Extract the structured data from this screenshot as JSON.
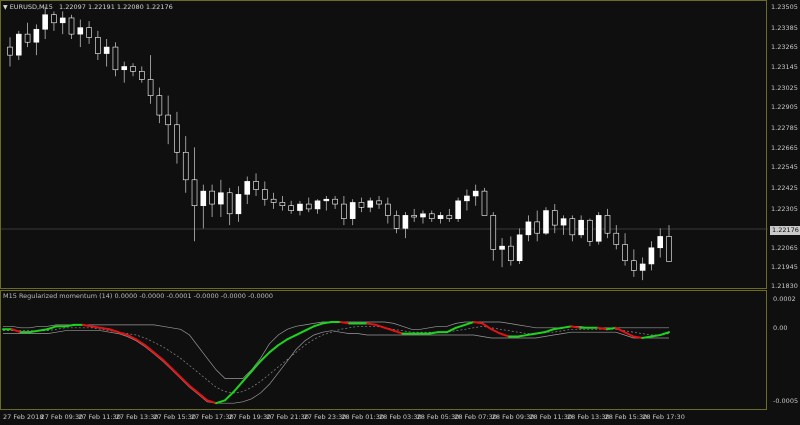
{
  "main_chart": {
    "symbol_label": "EURUSD,M15",
    "ohlc_text": "1.22097 1.22191 1.22080 1.22176",
    "dropdown_icon": "triangle-down-icon",
    "current_price": "1.22176",
    "price_axis": [
      "1.23505",
      "1.23385",
      "1.23265",
      "1.23145",
      "1.23025",
      "1.22905",
      "1.22785",
      "1.22665",
      "1.22545",
      "1.22425",
      "1.22305",
      "1.22065",
      "1.21945",
      "1.21830"
    ],
    "colors": {
      "background": "#0f0f0f",
      "frame": "#6b6b24",
      "candle": "#ffffff",
      "wick": "#bbbbbb"
    }
  },
  "indicator": {
    "title": "M15 Regularized momentum (14) 0.0000 -0.0000 -0.0001 -0.0000 -0.0000 -0.0000",
    "axis": [
      "0.0002",
      "0.00",
      "-0.0005"
    ],
    "colors": {
      "up": "#1fd41f",
      "down": "#e01414",
      "band": "#9a9a9a"
    }
  },
  "time_axis": [
    "27 Feb 2018",
    "27 Feb 09:30",
    "27 Feb 11:30",
    "27 Feb 13:30",
    "27 Feb 15:30",
    "27 Feb 17:30",
    "27 Feb 19:30",
    "27 Feb 21:30",
    "27 Feb 23:30",
    "28 Feb 01:30",
    "28 Feb 03:30",
    "28 Feb 05:30",
    "28 Feb 07:30",
    "28 Feb 09:30",
    "28 Feb 11:30",
    "28 Feb 13:30",
    "28 Feb 15:30",
    "28 Feb 17:30"
  ],
  "chart_data": [
    {
      "type": "candlestick",
      "title": "EURUSD,M15",
      "ylim": [
        1.2183,
        1.2356
      ],
      "candles": [
        [
          1.233,
          1.2336,
          1.2318,
          1.2325
        ],
        [
          1.2325,
          1.234,
          1.2322,
          1.2338
        ],
        [
          1.2338,
          1.2345,
          1.233,
          1.2333
        ],
        [
          1.2333,
          1.2344,
          1.2325,
          1.2341
        ],
        [
          1.2341,
          1.2355,
          1.2335,
          1.235
        ],
        [
          1.235,
          1.2352,
          1.234,
          1.2345
        ],
        [
          1.2345,
          1.2352,
          1.2338,
          1.2348
        ],
        [
          1.2348,
          1.235,
          1.2335,
          1.2338
        ],
        [
          1.2338,
          1.2347,
          1.233,
          1.2342
        ],
        [
          1.2342,
          1.2346,
          1.2332,
          1.2336
        ],
        [
          1.2336,
          1.234,
          1.2322,
          1.2326
        ],
        [
          1.2326,
          1.2335,
          1.2318,
          1.233
        ],
        [
          1.233,
          1.2333,
          1.2312,
          1.2316
        ],
        [
          1.2316,
          1.2321,
          1.2308,
          1.2318
        ],
        [
          1.2318,
          1.232,
          1.2312,
          1.2315
        ],
        [
          1.2315,
          1.2318,
          1.2308,
          1.231
        ],
        [
          1.231,
          1.2325,
          1.2295,
          1.23
        ],
        [
          1.23,
          1.2305,
          1.2283,
          1.2288
        ],
        [
          1.2288,
          1.23,
          1.227,
          1.2282
        ],
        [
          1.2282,
          1.229,
          1.2258,
          1.2265
        ],
        [
          1.2265,
          1.2275,
          1.224,
          1.2248
        ],
        [
          1.2248,
          1.2268,
          1.221,
          1.2232
        ],
        [
          1.2232,
          1.2245,
          1.2218,
          1.2241
        ],
        [
          1.2241,
          1.2245,
          1.2225,
          1.2233
        ],
        [
          1.2233,
          1.2248,
          1.2225,
          1.224
        ],
        [
          1.224,
          1.2243,
          1.222,
          1.2227
        ],
        [
          1.2227,
          1.2244,
          1.2222,
          1.2239
        ],
        [
          1.2239,
          1.225,
          1.2233,
          1.2247
        ],
        [
          1.2247,
          1.2252,
          1.2238,
          1.2242
        ],
        [
          1.2242,
          1.2247,
          1.2232,
          1.2236
        ],
        [
          1.2236,
          1.224,
          1.223,
          1.2234
        ],
        [
          1.2234,
          1.2238,
          1.2229,
          1.2232
        ],
        [
          1.2232,
          1.2235,
          1.2227,
          1.2229
        ],
        [
          1.2229,
          1.2235,
          1.2226,
          1.2233
        ],
        [
          1.2233,
          1.2237,
          1.2228,
          1.223
        ],
        [
          1.223,
          1.2236,
          1.2227,
          1.2235
        ],
        [
          1.2235,
          1.2238,
          1.2229,
          1.2236
        ],
        [
          1.2236,
          1.2238,
          1.223,
          1.2233
        ],
        [
          1.2233,
          1.2238,
          1.222,
          1.2224
        ],
        [
          1.2224,
          1.2236,
          1.222,
          1.2234
        ],
        [
          1.2234,
          1.2237,
          1.2228,
          1.2231
        ],
        [
          1.2231,
          1.2237,
          1.2228,
          1.2235
        ],
        [
          1.2235,
          1.2238,
          1.223,
          1.2233
        ],
        [
          1.2233,
          1.2237,
          1.2221,
          1.2226
        ],
        [
          1.2226,
          1.2229,
          1.2215,
          1.2218
        ],
        [
          1.2218,
          1.2228,
          1.2212,
          1.2226
        ],
        [
          1.2226,
          1.223,
          1.2222,
          1.2225
        ],
        [
          1.2225,
          1.2229,
          1.2221,
          1.2227
        ],
        [
          1.2227,
          1.2229,
          1.2222,
          1.2224
        ],
        [
          1.2224,
          1.2228,
          1.2221,
          1.2226
        ],
        [
          1.2226,
          1.223,
          1.2222,
          1.2224
        ],
        [
          1.2224,
          1.2237,
          1.2222,
          1.2235
        ],
        [
          1.2235,
          1.2242,
          1.2229,
          1.2238
        ],
        [
          1.2238,
          1.2245,
          1.2232,
          1.2241
        ],
        [
          1.2241,
          1.2243,
          1.2226,
          1.2226
        ],
        [
          1.2226,
          1.2228,
          1.2198,
          1.2205
        ],
        [
          1.2205,
          1.2212,
          1.2194,
          1.2207
        ],
        [
          1.2207,
          1.2213,
          1.2195,
          1.2198
        ],
        [
          1.2198,
          1.2218,
          1.2196,
          1.2214
        ],
        [
          1.2214,
          1.2226,
          1.221,
          1.2222
        ],
        [
          1.2222,
          1.2229,
          1.221,
          1.2215
        ],
        [
          1.2215,
          1.2231,
          1.2214,
          1.2229
        ],
        [
          1.2229,
          1.2233,
          1.2215,
          1.222
        ],
        [
          1.222,
          1.2226,
          1.2214,
          1.2224
        ],
        [
          1.2224,
          1.2226,
          1.221,
          1.2214
        ],
        [
          1.2214,
          1.2226,
          1.2212,
          1.2223
        ],
        [
          1.2223,
          1.2224,
          1.2207,
          1.221
        ],
        [
          1.221,
          1.2228,
          1.2208,
          1.2226
        ],
        [
          1.2226,
          1.223,
          1.2212,
          1.2215
        ],
        [
          1.2215,
          1.222,
          1.2205,
          1.2208
        ],
        [
          1.2208,
          1.2215,
          1.2195,
          1.2198
        ],
        [
          1.2198,
          1.2205,
          1.2188,
          1.2192
        ],
        [
          1.2192,
          1.22,
          1.2186,
          1.2196
        ],
        [
          1.2196,
          1.221,
          1.2192,
          1.2206
        ],
        [
          1.2206,
          1.2218,
          1.22,
          1.2213
        ],
        [
          1.2213,
          1.222,
          1.2208,
          1.21976
        ]
      ],
      "last_price": 1.22176
    },
    {
      "type": "line",
      "title": "Regularized momentum (14)",
      "ylim": [
        -0.00055,
        0.00025
      ],
      "x_count": 76,
      "series": [
        {
          "name": "momentum",
          "values": [
            0.0,
            0.0,
            -2e-05,
            -2e-05,
            -1e-05,
            0.0,
            2e-05,
            2e-05,
            3e-05,
            3e-05,
            2e-05,
            1e-05,
            0.0,
            -2e-05,
            -4e-05,
            -7e-05,
            -0.00011,
            -0.00016,
            -0.00021,
            -0.00027,
            -0.00033,
            -0.00039,
            -0.00044,
            -0.00049,
            -0.00051,
            -0.00049,
            -0.00043,
            -0.00036,
            -0.00029,
            -0.00022,
            -0.00016,
            -0.00011,
            -7e-05,
            -4e-05,
            -1e-05,
            2e-05,
            4e-05,
            5e-05,
            5e-05,
            4e-05,
            4e-05,
            4e-05,
            3e-05,
            1e-05,
            -1e-05,
            -3e-05,
            -3e-05,
            -3e-05,
            -3e-05,
            -2e-05,
            -2e-05,
            1e-05,
            3e-05,
            5e-05,
            4e-05,
            0.0,
            -3e-05,
            -5e-05,
            -5e-05,
            -4e-05,
            -3e-05,
            -2e-05,
            0.0,
            1e-05,
            2e-05,
            1e-05,
            1e-05,
            1e-05,
            0.0,
            1e-05,
            -2e-05,
            -5e-05,
            -6e-05,
            -5e-05,
            -4e-05,
            -2e-05
          ]
        },
        {
          "name": "upper band",
          "values": [
            2e-05,
            2e-05,
            1e-05,
            1e-05,
            2e-05,
            2e-05,
            3e-05,
            3e-05,
            3e-05,
            3e-05,
            3e-05,
            3e-05,
            3e-05,
            3e-05,
            3e-05,
            3e-05,
            3e-05,
            3e-05,
            2e-05,
            1e-05,
            0.0,
            -4e-05,
            -0.00012,
            -0.0002,
            -0.00028,
            -0.00034,
            -0.00034,
            -0.00034,
            -0.00028,
            -0.0002,
            -0.0001,
            -4e-05,
            0.0,
            2e-05,
            3e-05,
            4e-05,
            5e-05,
            5e-05,
            5e-05,
            5e-05,
            5e-05,
            5e-05,
            5e-05,
            5e-05,
            4e-05,
            2e-05,
            0.0,
            0.0,
            1e-05,
            2e-05,
            2e-05,
            4e-05,
            5e-05,
            5e-05,
            5e-05,
            5e-05,
            5e-05,
            4e-05,
            3e-05,
            2e-05,
            1e-05,
            1e-05,
            1e-05,
            1e-05,
            2e-05,
            2e-05,
            1e-05,
            1e-05,
            1e-05,
            1e-05,
            1e-05,
            1e-05,
            1e-05,
            1e-05,
            1e-05,
            1e-05
          ]
        },
        {
          "name": "lower band",
          "values": [
            -3e-05,
            -3e-05,
            -3e-05,
            -3e-05,
            -3e-05,
            -3e-05,
            -2e-05,
            -1e-05,
            -1e-05,
            -1e-05,
            -1e-05,
            -1e-05,
            -2e-05,
            -3e-05,
            -5e-05,
            -8e-05,
            -0.00012,
            -0.00017,
            -0.00022,
            -0.00028,
            -0.00034,
            -0.0004,
            -0.00045,
            -0.0005,
            -0.00051,
            -0.00051,
            -0.00051,
            -0.0005,
            -0.00048,
            -0.00044,
            -0.00038,
            -0.0003,
            -0.00022,
            -0.00014,
            -8e-05,
            -4e-05,
            -2e-05,
            -1e-05,
            -2e-05,
            -3e-05,
            -3e-05,
            -4e-05,
            -4e-05,
            -4e-05,
            -4e-05,
            -4e-05,
            -4e-05,
            -4e-05,
            -4e-05,
            -4e-05,
            -4e-05,
            -4e-05,
            -4e-05,
            -4e-05,
            -5e-05,
            -6e-05,
            -6e-05,
            -6e-05,
            -6e-05,
            -6e-05,
            -6e-05,
            -5e-05,
            -4e-05,
            -3e-05,
            -2e-05,
            -2e-05,
            -2e-05,
            -2e-05,
            -2e-05,
            -2e-05,
            -4e-05,
            -6e-05,
            -6e-05,
            -6e-05,
            -6e-05,
            -6e-05
          ]
        },
        {
          "name": "signal",
          "values": [
            -1e-05,
            -1e-05,
            -1e-05,
            -1e-05,
            -1e-05,
            -1e-05,
            0.0,
            1e-05,
            1e-05,
            1e-05,
            1e-05,
            0.0,
            -1e-05,
            -2e-05,
            -3e-05,
            -4e-05,
            -6e-05,
            -9e-05,
            -0.00012,
            -0.00016,
            -0.0002,
            -0.00025,
            -0.0003,
            -0.00035,
            -0.0004,
            -0.00043,
            -0.00044,
            -0.00043,
            -0.0004,
            -0.00036,
            -0.00031,
            -0.00026,
            -0.00021,
            -0.00016,
            -0.00011,
            -7e-05,
            -4e-05,
            -2e-05,
            0.0,
            1e-05,
            2e-05,
            2e-05,
            2e-05,
            1e-05,
            0.0,
            -1e-05,
            -2e-05,
            -2e-05,
            -2e-05,
            -2e-05,
            -2e-05,
            -1e-05,
            0.0,
            1e-05,
            2e-05,
            1e-05,
            0.0,
            -1e-05,
            -2e-05,
            -3e-05,
            -3e-05,
            -2e-05,
            -2e-05,
            -1e-05,
            0.0,
            0.0,
            0.0,
            0.0,
            0.0,
            0.0,
            -1e-05,
            -2e-05,
            -3e-05,
            -4e-05,
            -4e-05,
            -3e-05
          ]
        }
      ]
    }
  ]
}
